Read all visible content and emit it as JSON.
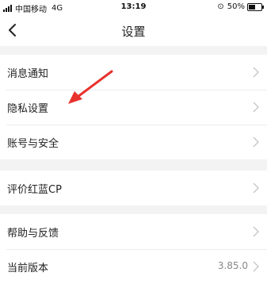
{
  "status_bar": {
    "carrier": "中国移动",
    "network": "4G",
    "time": "13:19",
    "battery": "50%"
  },
  "nav": {
    "title": "设置"
  },
  "groups": [
    {
      "items": [
        {
          "label": "消息通知"
        },
        {
          "label": "隐私设置"
        },
        {
          "label": "账号与安全"
        }
      ]
    },
    {
      "items": [
        {
          "label": "评价红蓝CP"
        }
      ]
    },
    {
      "items": [
        {
          "label": "帮助与反馈"
        },
        {
          "label": "当前版本",
          "value": "3.85.0"
        }
      ]
    }
  ],
  "colors": {
    "background": "#f3f3f3",
    "annotation_arrow": "#e8322d"
  }
}
